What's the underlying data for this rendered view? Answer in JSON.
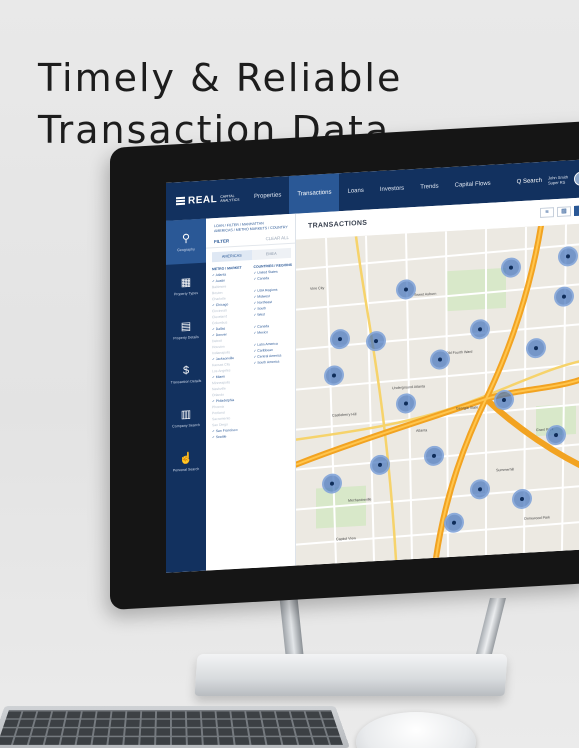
{
  "headline": {
    "line1": "Timely & Reliable",
    "line2": "Transaction Data"
  },
  "app": {
    "logo": {
      "word": "REAL",
      "sub1": "CAPITAL",
      "sub2": "ANALYTICS"
    },
    "nav": {
      "tabs": [
        "Properties",
        "Transactions",
        "Loans",
        "Investors",
        "Trends",
        "Capital Flows"
      ],
      "active": "Transactions",
      "search_label": "Q Search",
      "user_name": "John Smith",
      "user_sub": "Super RS"
    },
    "rail": [
      {
        "label": "Geography",
        "icon": "map-pin-icon"
      },
      {
        "label": "Property Types",
        "icon": "building-icon"
      },
      {
        "label": "Property Details",
        "icon": "document-icon"
      },
      {
        "label": "Transaction Details",
        "icon": "dollar-icon"
      },
      {
        "label": "Company Search",
        "icon": "book-icon"
      },
      {
        "label": "Personal Search",
        "icon": "touch-icon"
      }
    ],
    "filter": {
      "breadcrumb1": "LOAN / FILTER / MANHATTAN",
      "breadcrumb2": "AMERICAS / METRO MARKETS / COUNTRY",
      "filter_label": "FILTER",
      "clear_label": "CLEAR ALL",
      "region_tabs": [
        "AMERICAS",
        "EMEA"
      ],
      "col1_header": "METRO / MARKET",
      "col1": [
        "Atlanta",
        "Austin",
        "Baltimore",
        "Boston",
        "Charlotte",
        "Chicago",
        "Cincinnati",
        "Cleveland",
        "Columbus",
        "Dallas",
        "Denver",
        "Detroit",
        "Houston",
        "Indianapolis",
        "Jacksonville",
        "Kansas City",
        "Los Angeles",
        "Miami",
        "Minneapolis",
        "Nashville",
        "Orlando",
        "Philadelphia",
        "Phoenix",
        "Portland",
        "Sacramento",
        "San Diego",
        "San Francisco",
        "Seattle"
      ],
      "col1_dim": [
        2,
        3,
        4,
        6,
        7,
        8,
        11,
        12,
        13,
        15,
        16,
        18,
        19,
        20,
        22,
        23,
        24,
        25
      ],
      "col2_header": "COUNTRIES / REGIONS",
      "col2": [
        "United States",
        "Canada",
        "",
        "USA Regions",
        "Midwest",
        "Northeast",
        "South",
        "West",
        "",
        "Canada",
        "Mexico",
        "",
        "Latin America",
        "Caribbean",
        "Central America",
        "South America"
      ]
    },
    "main": {
      "title": "TRANSACTIONS",
      "view_buttons": [
        "list-icon",
        "grid-icon",
        "map-pin-icon"
      ],
      "map_labels": [
        "Vine City",
        "Sweet Auburn",
        "Old Fourth Ward",
        "Underground Atlanta",
        "Castleberry Hill",
        "Georgia State",
        "Mechanicsville",
        "Summerhill",
        "Grant Park",
        "Capitol View",
        "Ormewood Park",
        "Atlanta"
      ],
      "cluster_count": 19,
      "zoom": [
        "+",
        "−"
      ]
    }
  },
  "colors": {
    "nav_bg": "#12315f",
    "nav_active": "#2a5896",
    "accent": "#2a5896",
    "cluster": "#4676be",
    "highway": "#f2a321"
  }
}
